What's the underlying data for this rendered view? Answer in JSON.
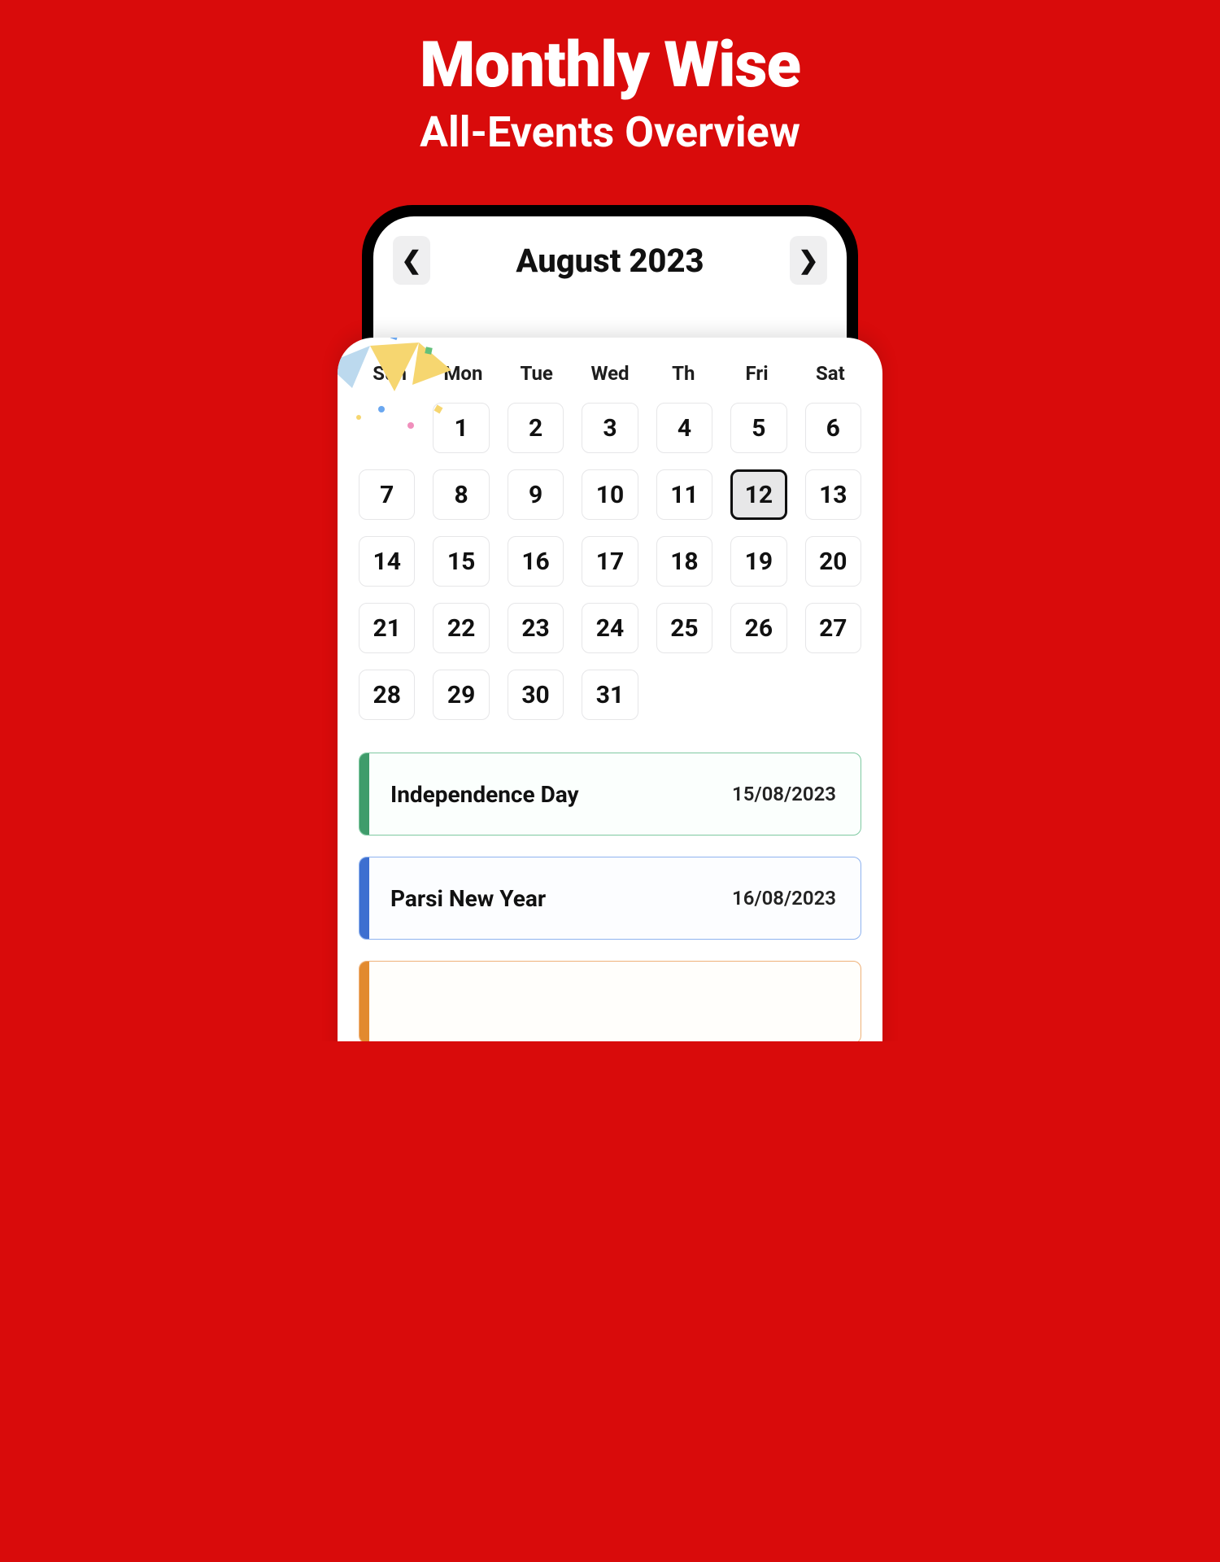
{
  "headline": {
    "title": "Monthly Wise",
    "subtitle": "All-Events Overview"
  },
  "calendar": {
    "month_label": "August 2023",
    "weekdays": [
      "Sun",
      "Mon",
      "Tue",
      "Wed",
      "Th",
      "Fri",
      "Sat"
    ],
    "leading_blanks": 1,
    "days_in_month": 31,
    "selected_day": 12
  },
  "events": [
    {
      "name": "Independence Day",
      "date": "15/08/2023",
      "color": "green"
    },
    {
      "name": "Parsi New Year",
      "date": "16/08/2023",
      "color": "blue"
    },
    {
      "name": "",
      "date": "",
      "color": "orange"
    }
  ]
}
